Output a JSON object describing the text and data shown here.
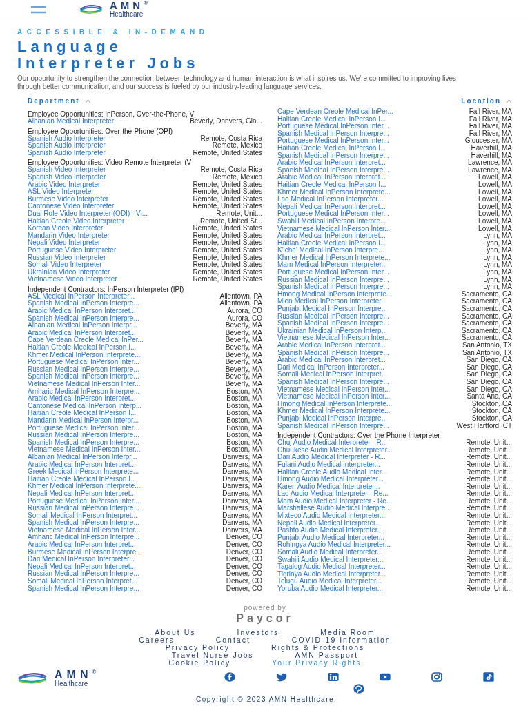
{
  "header": {
    "logo": {
      "name": "AMN$^{®}$",
      "tagline": "Healthcare"
    }
  },
  "hero": {
    "eyebrow": "ACCESSIBLE & IN-DEMAND",
    "title": "Language Interpreter Jobs",
    "description": "Our opportunity to strengthen the connection between technology and human interaction is what inspires us. We're committed to improving lives through better communication, and our success is fueled by our industry-leading language services."
  },
  "filters": [
    {
      "label": "Department"
    },
    {
      "label": "Location"
    }
  ],
  "sections": [
    {
      "title": "Employee Opportunities: InPerson, Over-the-Phone, V",
      "jobs": [
        {
          "title": "Albanian Medical Interpreter",
          "location": "Beverly, Danvers, Gla..."
        }
      ]
    },
    {
      "title": "Employee Opportunities: Over-the-Phone (OPI)",
      "jobs": [
        {
          "title": "Spanish Audio Interpreter",
          "location": "Remote, Costa Rica"
        },
        {
          "title": "Spanish Audio Interpreter",
          "location": "Remote, Mexico"
        },
        {
          "title": "Spanish Audio Interpreter",
          "location": "Remote, United States"
        }
      ]
    },
    {
      "title": "Employee Opportunities: Video Remote Interpreter (V",
      "jobs": [
        {
          "title": "Spanish Video Interpreter",
          "location": "Remote, Costa Rica"
        },
        {
          "title": "Spanish Video Interpreter",
          "location": "Remote, Mexico"
        },
        {
          "title": "Arabic Video Interpreter",
          "location": "Remote, United States"
        },
        {
          "title": "ASL Video Interpreter",
          "location": "Remote, United States"
        },
        {
          "title": "Burmese Video Interpreter",
          "location": "Remote, United States"
        },
        {
          "title": "Cantonese Video Interpreter",
          "location": "Remote, United States"
        },
        {
          "title": "Dual Role Video Interpreter (ODI) - Vi...",
          "location": "Remote, Unit..."
        },
        {
          "title": "Haitian Creole Video Interpreter",
          "location": "Remote, United St..."
        },
        {
          "title": "Korean Video Interpreter",
          "location": "Remote, United States"
        },
        {
          "title": "Mandarin Video Interpreter",
          "location": "Remote, United States"
        },
        {
          "title": "Nepali Video Interpreter",
          "location": "Remote, United States"
        },
        {
          "title": "Portuguese Video Interpreter",
          "location": "Remote, United States"
        },
        {
          "title": "Russian Video Interpreter",
          "location": "Remote, United States"
        },
        {
          "title": "Somali Video Interpreter",
          "location": "Remote, United States"
        },
        {
          "title": "Ukrainian Video Interpreter",
          "location": "Remote, United States"
        },
        {
          "title": "Vietnamese Video Interpreter",
          "location": "Remote, United States"
        }
      ]
    },
    {
      "title": "Independent Contractors: InPerson Interpreter (IPI)",
      "jobs": [
        {
          "title": "ASL Medical InPerson Interpreter...",
          "location": "Allentown, PA"
        },
        {
          "title": "Spanish Medical InPerson Interpre...",
          "location": "Allentown, PA"
        },
        {
          "title": "Arabic Medical InPerson Interpret...",
          "location": "Aurora, CO"
        },
        {
          "title": "Spanish Medical InPerson Interpre...",
          "location": "Aurora, CO"
        },
        {
          "title": "Albanian Medical InPerson Interpr...",
          "location": "Beverly, MA"
        },
        {
          "title": "Arabic Medical InPerson Interpret...",
          "location": "Beverly, MA"
        },
        {
          "title": "Cape Verdean Creole Medical InPer...",
          "location": "Beverly, MA"
        },
        {
          "title": "Haitian Creole Medical InPerson I...",
          "location": "Beverly, MA"
        },
        {
          "title": "Khmer Medical InPerson Interprete...",
          "location": "Beverly, MA"
        },
        {
          "title": "Portuguese Medical InPerson Inter...",
          "location": "Beverly, MA"
        },
        {
          "title": "Russian Medical InPerson Interpre...",
          "location": "Beverly, MA"
        },
        {
          "title": "Spanish Medical InPerson Interpre...",
          "location": "Beverly, MA"
        },
        {
          "title": "Vietnamese Medical InPerson Inter...",
          "location": "Beverly, MA"
        },
        {
          "title": "Amharic Medical InPerson Interpre...",
          "location": "Boston, MA"
        },
        {
          "title": "Arabic Medical InPerson Interpret...",
          "location": "Boston, MA"
        },
        {
          "title": "Cantonese Medical InPerson Interp...",
          "location": "Boston, MA"
        },
        {
          "title": "Haitian Creole Medical InPerson I...",
          "location": "Boston, MA"
        },
        {
          "title": "Mandarin Medical InPerson Interpr...",
          "location": "Boston, MA"
        },
        {
          "title": "Portuguese Medical InPerson Inter...",
          "location": "Boston, MA"
        },
        {
          "title": "Russian Medical InPerson Interpre...",
          "location": "Boston, MA"
        },
        {
          "title": "Spanish Medical InPerson Interpre...",
          "location": "Boston, MA"
        },
        {
          "title": "Vietnamese Medical InPerson Inter...",
          "location": "Boston, MA"
        },
        {
          "title": "Albanian Medical InPerson Interpr...",
          "location": "Danvers, MA"
        },
        {
          "title": "Arabic Medical InPerson Interpret...",
          "location": "Danvers, MA"
        },
        {
          "title": "Greek Medical InPerson Interprete...",
          "location": "Danvers, MA"
        },
        {
          "title": "Haitian Creole Medical InPerson I...",
          "location": "Danvers, MA"
        },
        {
          "title": "Khmer Medical InPerson Interprete...",
          "location": "Danvers, MA"
        },
        {
          "title": "Nepali Medical InPerson Interpret...",
          "location": "Danvers, MA"
        },
        {
          "title": "Portuguese Medical InPerson Inter...",
          "location": "Danvers, MA"
        },
        {
          "title": "Russian Medical InPerson Interpre...",
          "location": "Danvers, MA"
        },
        {
          "title": "Somali Medical InPerson Interpret...",
          "location": "Danvers, MA"
        },
        {
          "title": "Spanish Medical InPerson Interpre...",
          "location": "Danvers, MA"
        },
        {
          "title": "Vietnamese Medical InPerson Inter...",
          "location": "Danvers, MA"
        },
        {
          "title": "Amharic Medical InPerson Interpre...",
          "location": "Denver, CO"
        },
        {
          "title": "Arabic Medical InPerson Interpret...",
          "location": "Denver, CO"
        },
        {
          "title": "Burmese Medical InPerson Interpre...",
          "location": "Denver, CO"
        },
        {
          "title": "Dari Medical InPerson Interpreter...",
          "location": "Denver, CO"
        },
        {
          "title": "Nepali Medical InPerson Interpret...",
          "location": "Denver, CO"
        },
        {
          "title": "Russian Medical InPerson Interpre...",
          "location": "Denver, CO"
        },
        {
          "title": "Somali Medical InPerson Interpret...",
          "location": "Denver, CO"
        },
        {
          "title": "Spanish Medical InPerson Interpre...",
          "location": "Denver, CO"
        },
        {
          "title": "Cape Verdean Creole Medical InPer...",
          "location": "Fall River, MA"
        },
        {
          "title": "Haitian Creole Medical InPerson I...",
          "location": "Fall River, MA"
        },
        {
          "title": "Portuguese Medical InPerson Inter...",
          "location": "Fall River, MA"
        },
        {
          "title": "Spanish Medical InPerson Interpre...",
          "location": "Fall River, MA"
        },
        {
          "title": "Portuguese Medical InPerson Inter...",
          "location": "Gloucester, MA"
        },
        {
          "title": "Haitian Creole Medical InPerson I...",
          "location": "Haverhill, MA"
        },
        {
          "title": "Spanish Medical InPerson Interpre...",
          "location": "Haverhill, MA"
        },
        {
          "title": "Arabic Medical InPerson Interpret...",
          "location": "Lawrence, MA"
        },
        {
          "title": "Spanish Medical InPerson Interpre...",
          "location": "Lawrence, MA"
        },
        {
          "title": "Arabic Medical InPerson Interpret...",
          "location": "Lowell, MA"
        },
        {
          "title": "Haitian Creole Medical InPerson I...",
          "location": "Lowell, MA"
        },
        {
          "title": "Khmer Medical InPerson Interprete...",
          "location": "Lowell, MA"
        },
        {
          "title": "Lao Medical InPerson Interpreter...",
          "location": "Lowell, MA"
        },
        {
          "title": "Nepali Medical InPerson Interpret...",
          "location": "Lowell, MA"
        },
        {
          "title": "Portuguese Medical InPerson Inter...",
          "location": "Lowell, MA"
        },
        {
          "title": "Swahili Medical InPerson Interpre...",
          "location": "Lowell, MA"
        },
        {
          "title": "Vietnamese Medical InPerson Inter...",
          "location": "Lowell, MA"
        },
        {
          "title": "Arabic Medical InPerson Interpret...",
          "location": "Lynn, MA"
        },
        {
          "title": "Haitian Creole Medical InPerson I...",
          "location": "Lynn, MA"
        },
        {
          "title": "K'iche' Medical InPerson Interpre...",
          "location": "Lynn, MA"
        },
        {
          "title": "Khmer Medical InPerson Interprete...",
          "location": "Lynn, MA"
        },
        {
          "title": "Mam Medical InPerson Interpreter...",
          "location": "Lynn, MA"
        },
        {
          "title": "Portuguese Medical InPerson Inter...",
          "location": "Lynn, MA"
        },
        {
          "title": "Russian Medical InPerson Interpre...",
          "location": "Lynn, MA"
        },
        {
          "title": "Spanish Medical InPerson Interpre...",
          "location": "Lynn, MA"
        },
        {
          "title": "Hmong Medical InPerson Interprete...",
          "location": "Sacramento, CA"
        },
        {
          "title": "Mien Medical InPerson Interpreter...",
          "location": "Sacramento, CA"
        },
        {
          "title": "Punjabi Medical InPerson Interpre...",
          "location": "Sacramento, CA"
        },
        {
          "title": "Russian Medical InPerson Interpre...",
          "location": "Sacramento, CA"
        },
        {
          "title": "Spanish Medical InPerson Interpre...",
          "location": "Sacramento, CA"
        },
        {
          "title": "Ukrainian Medical InPerson Interp...",
          "location": "Sacramento, CA"
        },
        {
          "title": "Vietnamese Medical InPerson Inter...",
          "location": "Sacramento, CA"
        },
        {
          "title": "Arabic Medical InPerson Interpret...",
          "location": "San Antonio, TX"
        },
        {
          "title": "Spanish Medical InPerson Interpre...",
          "location": "San Antonio, TX"
        },
        {
          "title": "Arabic Medical InPerson Interpret...",
          "location": "San Diego, CA"
        },
        {
          "title": "Dari Medical InPerson Interpreter...",
          "location": "San Diego, CA"
        },
        {
          "title": "Somali Medical InPerson Interpret...",
          "location": "San Diego, CA"
        },
        {
          "title": "Spanish Medical InPerson Interpre...",
          "location": "San Diego, CA"
        },
        {
          "title": "Vietnamese Medical InPerson Inter...",
          "location": "San Diego, CA"
        },
        {
          "title": "Vietnamese Medical InPerson Inter...",
          "location": "Santa Ana, CA"
        },
        {
          "title": "Hmong Medical InPerson Interprete...",
          "location": "Stockton, CA"
        },
        {
          "title": "Khmer Medical InPerson Interprete...",
          "location": "Stockton, CA"
        },
        {
          "title": "Punjabi Medical InPerson Interpre...",
          "location": "Stockton, CA"
        },
        {
          "title": "Spanish Medical InPerson Interpre...",
          "location": "West Hartford, CT"
        }
      ]
    },
    {
      "title": "Independent Contractors: Over-the-Phone Interpreter",
      "jobs": [
        {
          "title": "Chuj Audio Medical Interpreter - R...",
          "location": "Remote, Unit..."
        },
        {
          "title": "Chuukese Audio Medical Interpreter...",
          "location": "Remote, Unit..."
        },
        {
          "title": "Dari Audio Medical Interpreter - R...",
          "location": "Remote, Unit..."
        },
        {
          "title": "Fulani Audio Medical Interpreter...",
          "location": "Remote, Unit..."
        },
        {
          "title": "Haitian Creole Audio Medical Inter...",
          "location": "Remote, Unit..."
        },
        {
          "title": "Hmong Audio Medical Interpreter...",
          "location": "Remote, Unit..."
        },
        {
          "title": "Karen Audio Medical Interpreter...",
          "location": "Remote, Unit..."
        },
        {
          "title": "Lao Audio Medical Interpreter - Re...",
          "location": "Remote, Unit..."
        },
        {
          "title": "Mam Audio Medical Interpreter - Re...",
          "location": "Remote, Unit..."
        },
        {
          "title": "Marshallese Audio Medical Interpre...",
          "location": "Remote, Unit..."
        },
        {
          "title": "Mixteco Audio Medical Interpreter...",
          "location": "Remote, Unit..."
        },
        {
          "title": "Nepali Audio Medical Interpreter...",
          "location": "Remote, Unit..."
        },
        {
          "title": "Pashto Audio Medical Interpreter...",
          "location": "Remote, Unit..."
        },
        {
          "title": "Punjabi Audio Medical Interpreter...",
          "location": "Remote, Unit..."
        },
        {
          "title": "Rohingya Audio Medical Interpreter...",
          "location": "Remote, Unit..."
        },
        {
          "title": "Somali Audio Medical Interpreter...",
          "location": "Remote, Unit..."
        },
        {
          "title": "Swahili Audio Medical Interpreter...",
          "location": "Remote, Unit..."
        },
        {
          "title": "Tagalog Audio Medical Interpreter...",
          "location": "Remote, Unit..."
        },
        {
          "title": "Tigrinya Audio Medical Interpreter...",
          "location": "Remote, Unit..."
        },
        {
          "title": "Telugu Audio Medical Interpreter...",
          "location": "Remote, Unit..."
        },
        {
          "title": "Yoruba Audio Medical Interpreter...",
          "location": "Remote, Unit..."
        }
      ]
    }
  ],
  "powered_by": {
    "label": "powered by",
    "brand": "Paycor"
  },
  "footer": {
    "links": [
      {
        "label": "About Us",
        "kind": "nav"
      },
      {
        "label": "Investors",
        "kind": "nav"
      },
      {
        "label": "Media Room",
        "kind": "nav"
      },
      {
        "label": "Careers",
        "kind": "nav"
      },
      {
        "label": "Contact",
        "kind": "nav"
      },
      {
        "label": "COVID-19 Information",
        "kind": "nav"
      },
      {
        "label": "Privacy Policy",
        "kind": "nav"
      },
      {
        "label": "Rights & Protections",
        "kind": "nav"
      },
      {
        "label": "Travel Nurse Jobs",
        "kind": "nav"
      },
      {
        "label": "AMN Passport",
        "kind": "nav"
      },
      {
        "label": "Cookie Policy",
        "kind": "nav"
      },
      {
        "label": "Your Privacy Rights",
        "kind": "privacy"
      }
    ],
    "logo": {
      "name": "AMN$^{®}$",
      "tagline": "Healthcare"
    },
    "copyright": "Copyright © 2023 AMN Healthcare"
  }
}
